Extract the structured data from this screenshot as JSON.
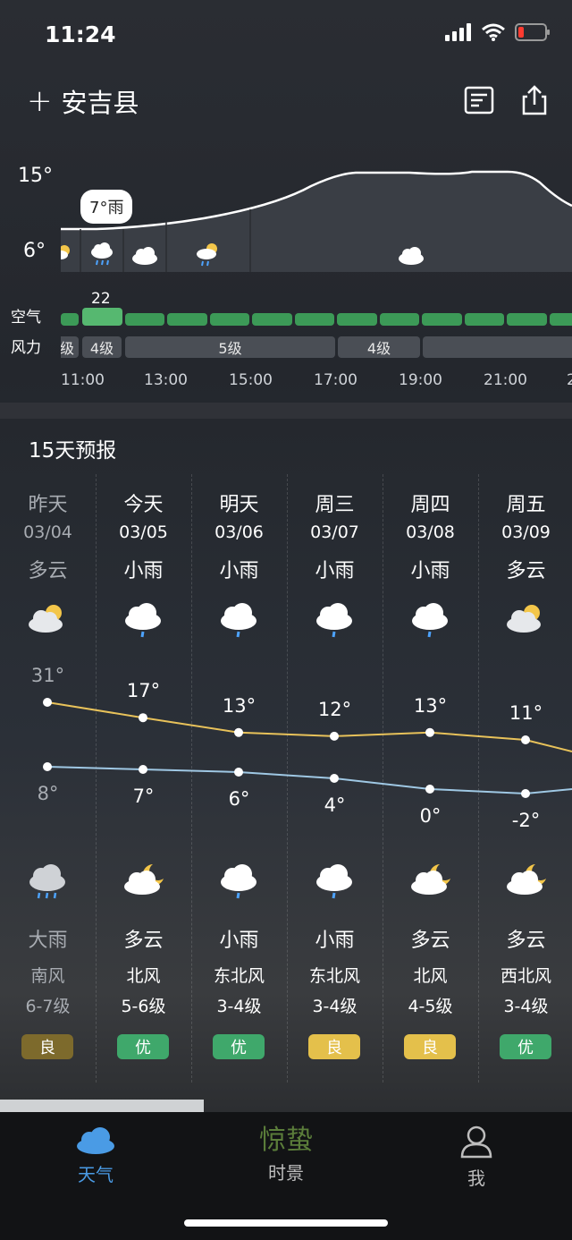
{
  "status_bar": {
    "time": "11:24"
  },
  "header": {
    "add_symbol": "+",
    "city": "安吉县"
  },
  "hourly": {
    "y_labels": [
      "15°",
      "6°"
    ],
    "tooltip": "7°雨",
    "air_label": "空气",
    "wind_label": "风力",
    "aqi_value": "22",
    "wind_levels": [
      "级",
      "4级",
      "5级",
      "4级"
    ],
    "times": [
      "11:00",
      "13:00",
      "15:00",
      "17:00",
      "19:00",
      "21:00",
      "2"
    ],
    "weather_icons": [
      "partly-sunny-icon",
      "light-rain-icon",
      "cloud-icon",
      "sun-rain-icon",
      "cloud-icon"
    ]
  },
  "forecast": {
    "title": "15天预报",
    "days": [
      {
        "day": "昨天",
        "date": "03/04",
        "day_weather": "多云",
        "high": "31°",
        "low": "8°",
        "night_weather": "大雨",
        "wind_dir": "南风",
        "wind_level": "6-7级",
        "aq": "良",
        "aq_color": "#7d6a2c",
        "day_icon": "partly-cloudy-icon",
        "night_icon": "heavy-rain-icon",
        "high_value": 31,
        "low_value": 8
      },
      {
        "day": "今天",
        "date": "03/05",
        "day_weather": "小雨",
        "high": "17°",
        "low": "7°",
        "night_weather": "多云",
        "wind_dir": "北风",
        "wind_level": "5-6级",
        "aq": "优",
        "aq_color": "#3fa86b",
        "day_icon": "light-rain-icon",
        "night_icon": "cloud-moon-icon",
        "high_value": 17,
        "low_value": 7
      },
      {
        "day": "明天",
        "date": "03/06",
        "day_weather": "小雨",
        "high": "13°",
        "low": "6°",
        "night_weather": "小雨",
        "wind_dir": "东北风",
        "wind_level": "3-4级",
        "aq": "优",
        "aq_color": "#3fa86b",
        "day_icon": "light-rain-icon",
        "night_icon": "light-rain-icon",
        "high_value": 13,
        "low_value": 6
      },
      {
        "day": "周三",
        "date": "03/07",
        "day_weather": "小雨",
        "high": "12°",
        "low": "4°",
        "night_weather": "小雨",
        "wind_dir": "东北风",
        "wind_level": "3-4级",
        "aq": "良",
        "aq_color": "#e4c04b",
        "day_icon": "light-rain-icon",
        "night_icon": "light-rain-icon",
        "high_value": 12,
        "low_value": 4
      },
      {
        "day": "周四",
        "date": "03/08",
        "day_weather": "小雨",
        "high": "13°",
        "low": "0°",
        "night_weather": "多云",
        "wind_dir": "北风",
        "wind_level": "4-5级",
        "aq": "良",
        "aq_color": "#e4c04b",
        "day_icon": "light-rain-icon",
        "night_icon": "cloud-moon-icon",
        "high_value": 13,
        "low_value": 0
      },
      {
        "day": "周五",
        "date": "03/09",
        "day_weather": "多云",
        "high": "11°",
        "low": "-2°",
        "night_weather": "多云",
        "wind_dir": "西北风",
        "wind_level": "3-4级",
        "aq": "优",
        "aq_color": "#3fa86b",
        "day_icon": "partly-cloudy-icon",
        "night_icon": "cloud-moon-icon",
        "high_value": 11,
        "low_value": -2
      }
    ]
  },
  "bottom_nav": [
    {
      "label": "天气",
      "icon": "cloud-icon",
      "active": true
    },
    {
      "label": "时景",
      "overlay": "惊蛰",
      "active": false
    },
    {
      "label": "我",
      "icon": "person-icon",
      "active": false
    }
  ],
  "colors": {
    "accent": "#4a9be5",
    "high_line": "#e8c25a",
    "low_line": "#9fc8e4",
    "aq_green": "#3c9a57"
  }
}
